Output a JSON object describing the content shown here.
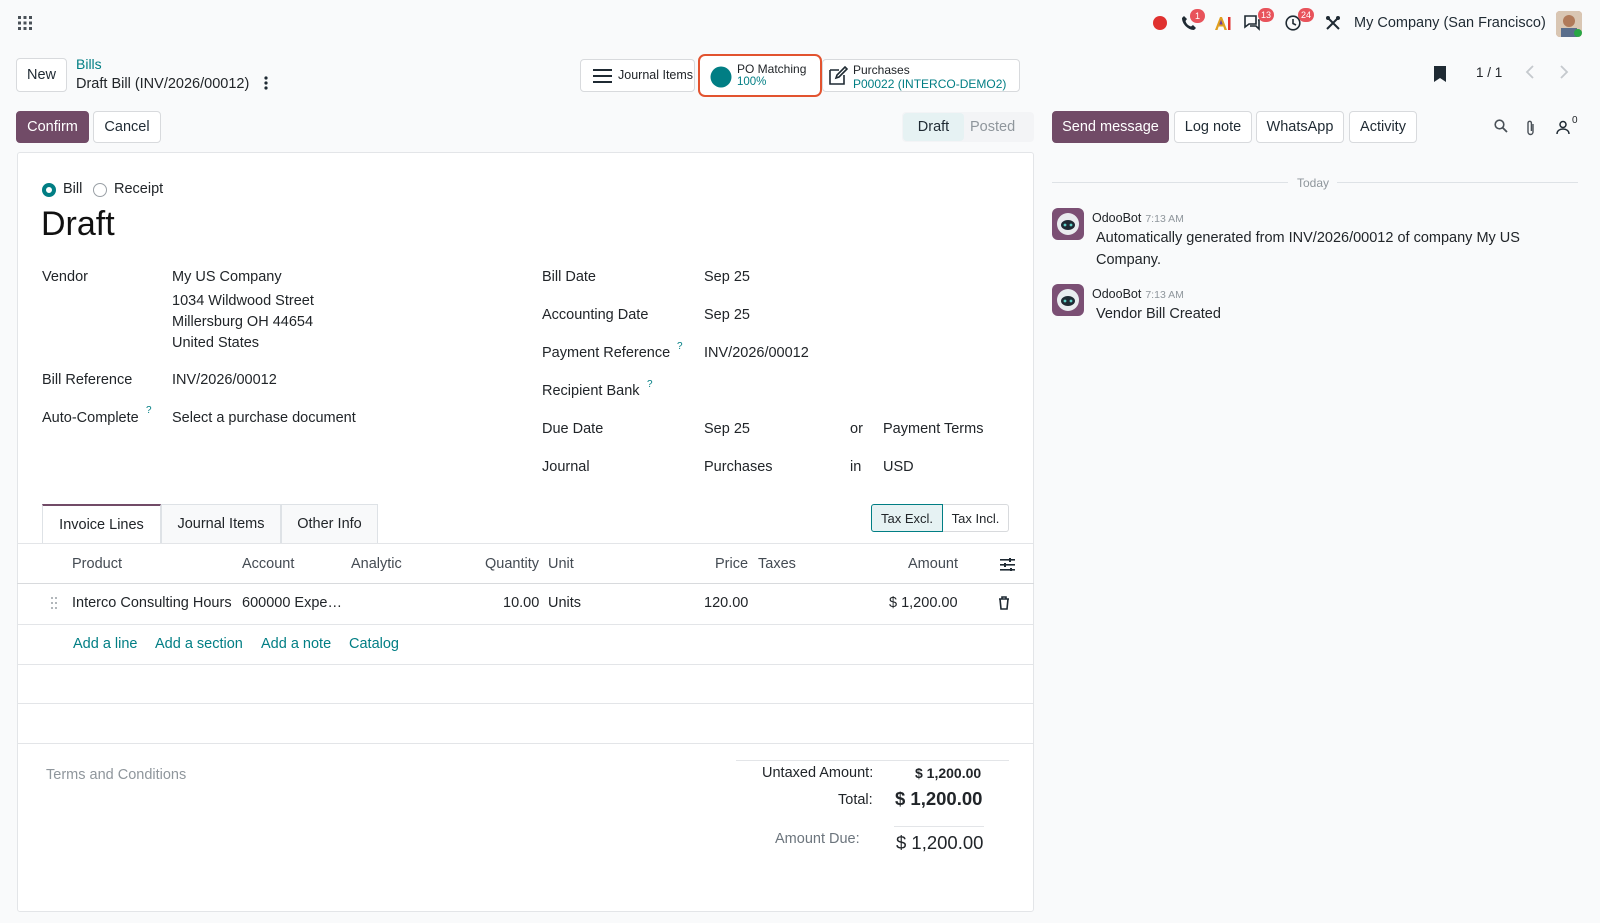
{
  "topbar": {
    "company": "My Company (San Francisco)",
    "badges": {
      "phone": "1",
      "messages": "13",
      "activities": "24"
    }
  },
  "breadcrumb": {
    "new": "New",
    "parent": "Bills",
    "current": "Draft Bill (INV/2026/00012)"
  },
  "smart_buttons": {
    "journal_items": "Journal Items",
    "po_matching_label": "PO Matching",
    "po_matching_value": "100%",
    "purchases_label": "Purchases",
    "purchases_value": "P00022 (INTERCO-DEMO2)"
  },
  "pager": {
    "text": "1 / 1"
  },
  "actions": {
    "confirm": "Confirm",
    "cancel": "Cancel"
  },
  "status": {
    "draft": "Draft",
    "posted": "Posted"
  },
  "chatter_actions": {
    "send": "Send message",
    "log": "Log note",
    "whatsapp": "WhatsApp",
    "activity": "Activity",
    "followers": "0"
  },
  "form": {
    "type_bill": "Bill",
    "type_receipt": "Receipt",
    "title": "Draft",
    "vendor_label": "Vendor",
    "vendor_name": "My US Company",
    "vendor_street": "1034 Wildwood Street",
    "vendor_city": "Millersburg OH 44654",
    "vendor_country": "United States",
    "bill_ref_label": "Bill Reference",
    "bill_ref": "INV/2026/00012",
    "autocomplete_label": "Auto-Complete",
    "autocomplete_placeholder": "Select a purchase document",
    "bill_date_label": "Bill Date",
    "bill_date": "Sep 25",
    "acc_date_label": "Accounting Date",
    "acc_date": "Sep 25",
    "pay_ref_label": "Payment Reference",
    "pay_ref": "INV/2026/00012",
    "bank_label": "Recipient Bank",
    "due_label": "Due Date",
    "due_date": "Sep 25",
    "or": "or",
    "payment_terms_placeholder": "Payment Terms",
    "journal_label": "Journal",
    "journal": "Purchases",
    "in": "in",
    "currency": "USD",
    "help": "?"
  },
  "tabs": {
    "invoice_lines": "Invoice Lines",
    "journal_items": "Journal Items",
    "other_info": "Other Info"
  },
  "tax_toggle": {
    "excl": "Tax Excl.",
    "incl": "Tax Incl."
  },
  "table": {
    "headers": {
      "product": "Product",
      "account": "Account",
      "analytic": "Analytic",
      "quantity": "Quantity",
      "unit": "Unit",
      "price": "Price",
      "taxes": "Taxes",
      "amount": "Amount"
    },
    "row": {
      "product": "Interco Consulting Hours",
      "account": "600000 Expe…",
      "quantity": "10.00",
      "unit": "Units",
      "price": "120.00",
      "amount": "$ 1,200.00"
    },
    "links": {
      "add_line": "Add a line",
      "add_section": "Add a section",
      "add_note": "Add a note",
      "catalog": "Catalog"
    }
  },
  "footer": {
    "terms_placeholder": "Terms and Conditions",
    "untaxed_label": "Untaxed Amount:",
    "untaxed": "$ 1,200.00",
    "total_label": "Total:",
    "total": "$ 1,200.00",
    "due_label": "Amount Due:",
    "due": "$ 1,200.00"
  },
  "chatter": {
    "today": "Today",
    "messages": [
      {
        "author": "OdooBot",
        "time": "7:13 AM",
        "body": "Automatically generated from INV/2026/00012 of company My US Company."
      },
      {
        "author": "OdooBot",
        "time": "7:13 AM",
        "body": "Vendor Bill Created"
      }
    ]
  },
  "colors": {
    "primary": "#714b67",
    "teal": "#017e84",
    "highlight": "#e2532f",
    "badge": "#e8535b"
  }
}
